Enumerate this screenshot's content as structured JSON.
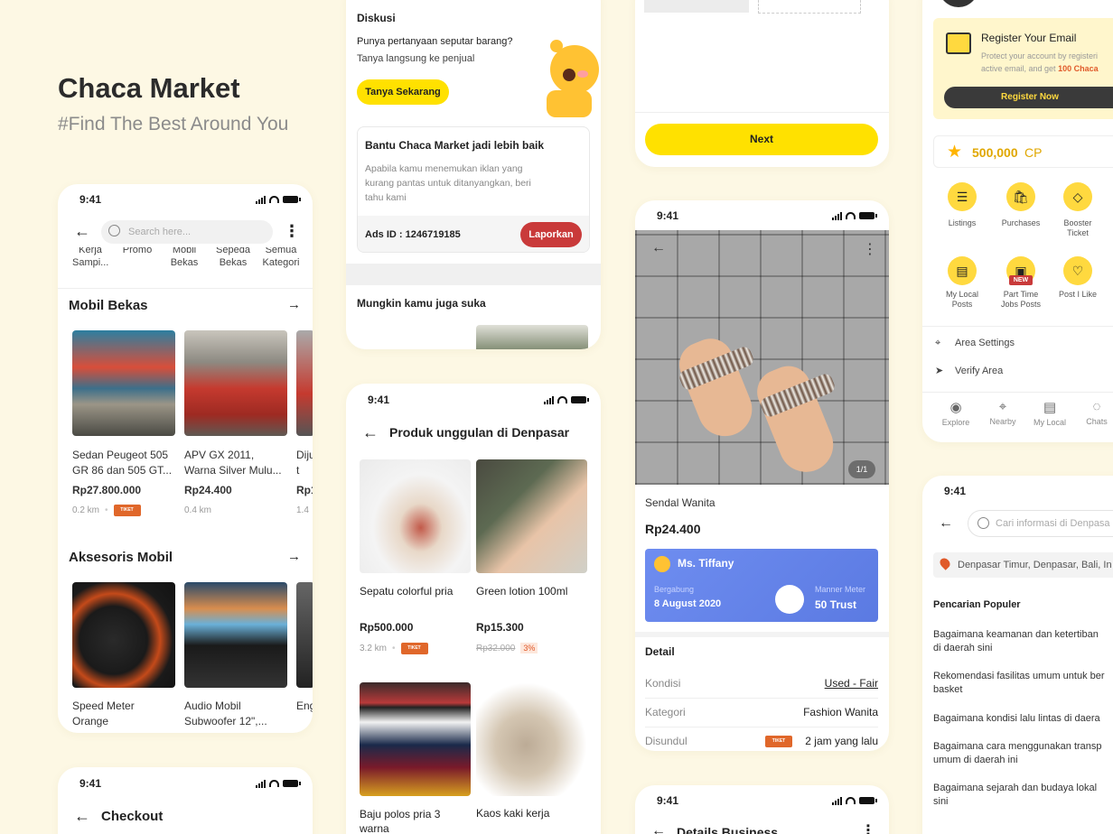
{
  "brand": {
    "title": "Chaca Market",
    "tagline": "#Find The Best Around You"
  },
  "status_time": "9:41",
  "screen_mobil": {
    "search_placeholder": "Search here...",
    "categories": [
      {
        "l1": "Kerja",
        "l2": "Sampi..."
      },
      {
        "l1": "Promo",
        "l2": ""
      },
      {
        "l1": "Mobil",
        "l2": "Bekas"
      },
      {
        "l1": "Sepeda",
        "l2": "Bekas"
      },
      {
        "l1": "Semua",
        "l2": "Kategori"
      }
    ],
    "section1": "Mobil Bekas",
    "section1_items": [
      {
        "name1": "Sedan Peugeot 505",
        "name2": "GR 86 dan 505 GT...",
        "price": "Rp27.800.000",
        "dist": "0.2 km"
      },
      {
        "name1": "APV GX 2011,",
        "name2": "Warna Silver Mulu...",
        "price": "Rp24.400",
        "dist": "0.4 km"
      },
      {
        "name1": "Diju",
        "name2": "t",
        "price": "Rp1",
        "dist": "1.4"
      }
    ],
    "section2": "Aksesoris Mobil",
    "section2_items": [
      {
        "name1": "Speed Meter",
        "name2": "Orange"
      },
      {
        "name1": "Audio Mobil",
        "name2": "Subwoofer 12\",..."
      },
      {
        "name1": "Eng",
        "name2": ""
      }
    ],
    "tiket_label": "TIKET"
  },
  "screen_checkout": {
    "title": "Checkout"
  },
  "screen_diskusi": {
    "heading": "Diskusi",
    "question": "Punya pertanyaan seputar barang?",
    "question_sub": "Tanya langsung ke penjual",
    "ask_button": "Tanya Sekarang",
    "report_title": "Bantu Chaca Market jadi lebih baik",
    "report_l1": "Apabila kamu menemukan iklan yang",
    "report_l2": "kurang pantas untuk ditanyangkan, beri",
    "report_l3": "tahu kami",
    "ads_id": "Ads ID : 1246719185",
    "report_button": "Laporkan",
    "suggest": "Mungkin kamu juga suka"
  },
  "screen_produk": {
    "title": "Produk unggulan di Denpasar",
    "items": [
      {
        "name": "Sepatu colorful pria",
        "price": "Rp500.000",
        "dist": "3.2 km"
      },
      {
        "name": "Green lotion 100ml",
        "price": "Rp15.300",
        "old_price": "Rp32.000",
        "discount": "3%"
      },
      {
        "name1": "Baju polos pria 3",
        "name2": "warna"
      },
      {
        "name": "Kaos kaki kerja"
      }
    ]
  },
  "screen_next": {
    "next_button": "Next"
  },
  "screen_sendal": {
    "image_counter": "1/1",
    "name": "Sendal Wanita",
    "price": "Rp24.400",
    "seller": "Ms. Tiffany",
    "joined_label": "Bergabung",
    "joined_date": "8 August 2020",
    "manner_label": "Manner Meter",
    "manner_value": "50 Trust",
    "detail_heading": "Detail",
    "rows": [
      {
        "k": "Kondisi",
        "v": "Used - Fair"
      },
      {
        "k": "Kategori",
        "v": "Fashion Wanita"
      },
      {
        "k": "Disundul",
        "v": "2 jam yang lalu"
      }
    ]
  },
  "screen_business": {
    "title": "Details Business"
  },
  "screen_profile": {
    "register_title": "Register Your Email",
    "register_l1": "Protect your account by registeri",
    "register_l2a": "active email, and get ",
    "register_l2b": "100 Chaca",
    "register_button": "Register Now",
    "points_value": "500,000",
    "points_unit": "CP",
    "menu": [
      {
        "l1": "Listings",
        "l2": ""
      },
      {
        "l1": "Purchases",
        "l2": ""
      },
      {
        "l1": "Booster",
        "l2": "Ticket"
      },
      {
        "l1": "My Local",
        "l2": "Posts"
      },
      {
        "l1": "Part Time",
        "l2": "Jobs Posts"
      },
      {
        "l1": "Post I Like",
        "l2": ""
      }
    ],
    "new_badge": "NEW",
    "area_settings": "Area Settings",
    "verify_area": "Verify Area",
    "nav": [
      "Explore",
      "Nearby",
      "My Local",
      "Chats"
    ]
  },
  "screen_search": {
    "placeholder": "Cari informasi di Denpasa",
    "location": "Denpasar Timur, Denpasar, Bali, In",
    "heading": "Pencarian Populer",
    "items": [
      {
        "l1": "Bagaimana keamanan dan ketertiban",
        "l2": "di daerah sini"
      },
      {
        "l1": "Rekomendasi fasilitas umum untuk ber",
        "l2": "basket"
      },
      {
        "l1": "Bagaimana kondisi lalu lintas di daera",
        "l2": ""
      },
      {
        "l1": "Bagaimana cara menggunakan transp",
        "l2": "umum di daerah ini"
      },
      {
        "l1": "Bagaimana sejarah dan budaya lokal",
        "l2": "sini"
      }
    ]
  }
}
